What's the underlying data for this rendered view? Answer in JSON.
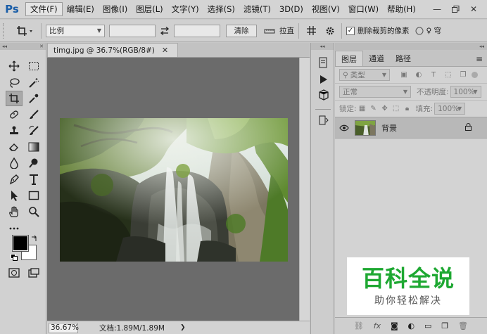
{
  "app": {
    "logo": "Ps"
  },
  "menu": {
    "items": [
      "文件(F)",
      "编辑(E)",
      "图像(I)",
      "图层(L)",
      "文字(Y)",
      "选择(S)",
      "滤镜(T)",
      "3D(D)",
      "视图(V)",
      "窗口(W)",
      "帮助(H)"
    ]
  },
  "options": {
    "ratio_select": "比例",
    "clear_button": "清除",
    "straighten_label": "拉直",
    "delete_cropped_label": "删除裁剪的像素",
    "delete_cropped_checked": true
  },
  "document": {
    "tab_title": "timg.jpg @ 36.7%(RGB/8#)",
    "zoom": "36.67%",
    "doc_info": "文档:1.89M/1.89M"
  },
  "layers_panel": {
    "tabs": [
      "图层",
      "通道",
      "路径"
    ],
    "active_tab": 0,
    "filter_kind": "类型",
    "blend_mode": "正常",
    "opacity_label": "不透明度:",
    "opacity_value": "100%",
    "lock_label": "锁定:",
    "fill_label": "填充:",
    "fill_value": "100%",
    "layers": [
      {
        "name": "背景",
        "visible": true,
        "locked": true
      }
    ]
  },
  "watermark": {
    "title": "百科全说",
    "subtitle": "助你轻松解决",
    "color": "#1ea832"
  },
  "icons": {
    "tools": [
      "move-icon",
      "marquee-icon",
      "lasso-icon",
      "magic-wand-icon",
      "crop-icon",
      "eyedropper-icon",
      "healing-icon",
      "brush-icon",
      "stamp-icon",
      "history-brush-icon",
      "eraser-icon",
      "gradient-icon",
      "blur-icon",
      "dodge-icon",
      "pen-icon",
      "type-icon",
      "path-select-icon",
      "rectangle-icon",
      "hand-icon",
      "zoom-icon",
      "more-icon"
    ]
  }
}
